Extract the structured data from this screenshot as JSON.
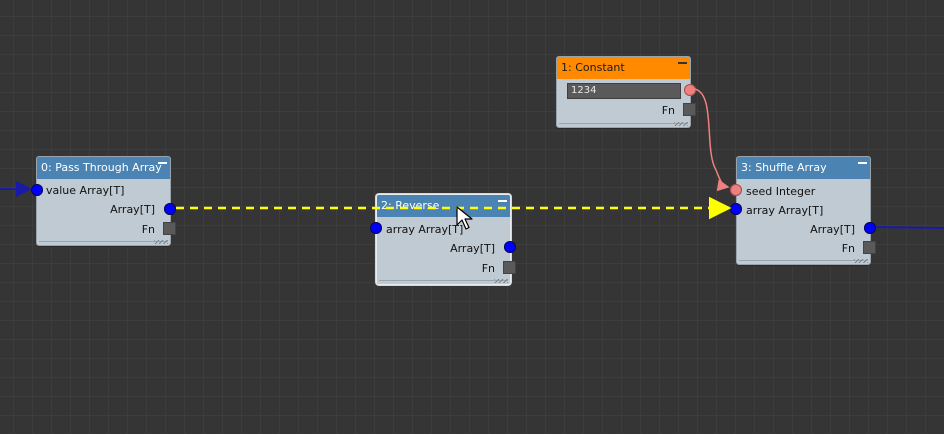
{
  "nodes": {
    "pass_through": {
      "title": "0: Pass Through Array",
      "input_label": "value Array[T]",
      "output_label": "Array[T]",
      "fn_label": "Fn"
    },
    "constant": {
      "title": "1: Constant",
      "value": "1234",
      "fn_label": "Fn"
    },
    "reverse": {
      "title": "2: Reverse",
      "input_label": "array Array[T]",
      "output_label": "Array[T]",
      "fn_label": "Fn"
    },
    "shuffle": {
      "title": "3: Shuffle Array",
      "seed_label": "seed Integer",
      "input_label": "array Array[T]",
      "output_label": "Array[T]",
      "fn_label": "Fn"
    }
  },
  "colors": {
    "title_bar": "#4b84b3",
    "constant_title_bar": "#ff8a00",
    "array_port": "#0000ff",
    "integer_port": "#f08080",
    "drag_link": "#ffff00",
    "canvas": "#353535",
    "node_body": "#bfcad2"
  },
  "icons": {
    "collapse": "minus-icon",
    "cursor": "arrow-cursor-icon",
    "function_port": "square-port-icon"
  }
}
